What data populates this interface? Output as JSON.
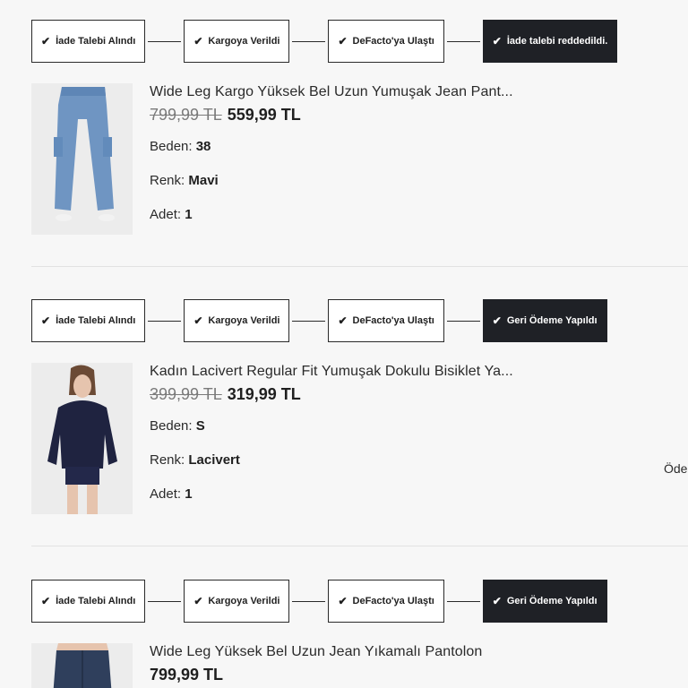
{
  "orders": [
    {
      "steps": [
        {
          "label": "İade Talebi Alındı"
        },
        {
          "label": "Kargoya Verildi"
        },
        {
          "label": "DeFacto'ya Ulaştı"
        },
        {
          "label": "İade talebi reddedildi."
        }
      ],
      "product": {
        "name": "Wide Leg Kargo Yüksek Bel Uzun Yumuşak Jean Pant...",
        "old_price": "799,99 TL",
        "price": "559,99 TL",
        "size_label": "Beden:",
        "size": "38",
        "color_label": "Renk:",
        "color": "Mavi",
        "qty_label": "Adet:",
        "qty": "1"
      }
    },
    {
      "steps": [
        {
          "label": "İade Talebi Alındı"
        },
        {
          "label": "Kargoya Verildi"
        },
        {
          "label": "DeFacto'ya Ulaştı"
        },
        {
          "label": "Geri Ödeme Yapıldı"
        }
      ],
      "product": {
        "name": "Kadın Lacivert Regular Fit Yumuşak Dokulu Bisiklet Ya...",
        "old_price": "399,99 TL",
        "price": "319,99 TL",
        "size_label": "Beden:",
        "size": "S",
        "color_label": "Renk:",
        "color": "Lacivert",
        "qty_label": "Adet:",
        "qty": "1"
      },
      "side_label": "Öde"
    },
    {
      "steps": [
        {
          "label": "İade Talebi Alındı"
        },
        {
          "label": "Kargoya Verildi"
        },
        {
          "label": "DeFacto'ya Ulaştı"
        },
        {
          "label": "Geri Ödeme Yapıldı"
        }
      ],
      "product": {
        "name": "Wide Leg Yüksek Bel Uzun Jean Yıkamalı Pantolon",
        "price": "799,99 TL"
      }
    }
  ],
  "colors": {
    "active_step_bg": "#1f2126",
    "border": "#2a2a2a",
    "background": "#f7f7f7"
  },
  "icons": {
    "step_check": "check-icon"
  }
}
